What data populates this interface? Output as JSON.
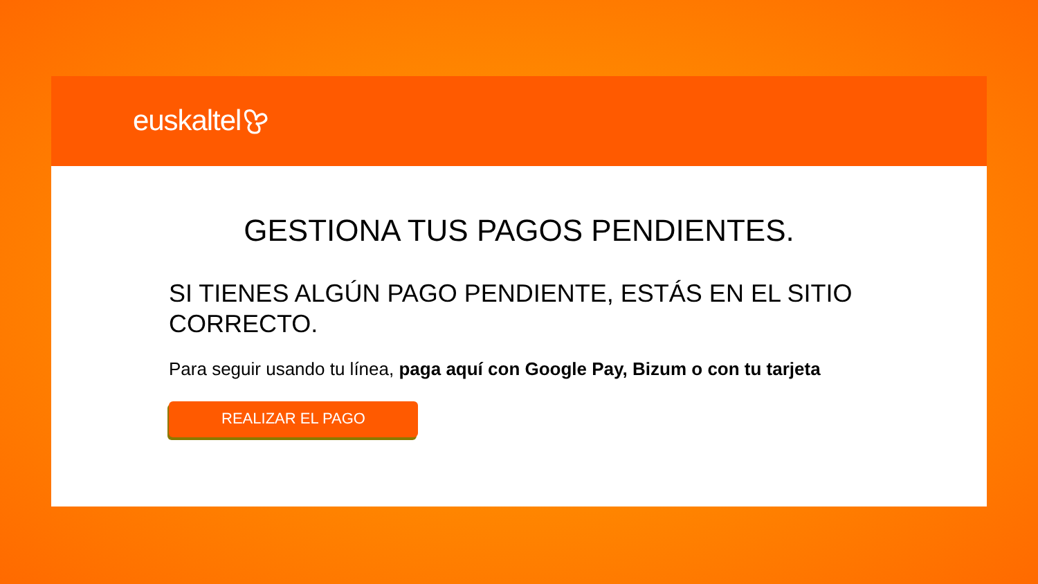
{
  "header": {
    "logo": "euskaltel"
  },
  "title": "GESTIONA TUS PAGOS PENDIENTES.",
  "subtitle": "SI TIENES ALGÚN PAGO PENDIENTE, ESTÁS EN EL SITIO CORRECTO.",
  "message": "Para seguir usando tu línea, **paga aquí con Google Pay, Bizum o con tu tarjeta**",
  "button": "REALIZAR EL PAGO"
}
